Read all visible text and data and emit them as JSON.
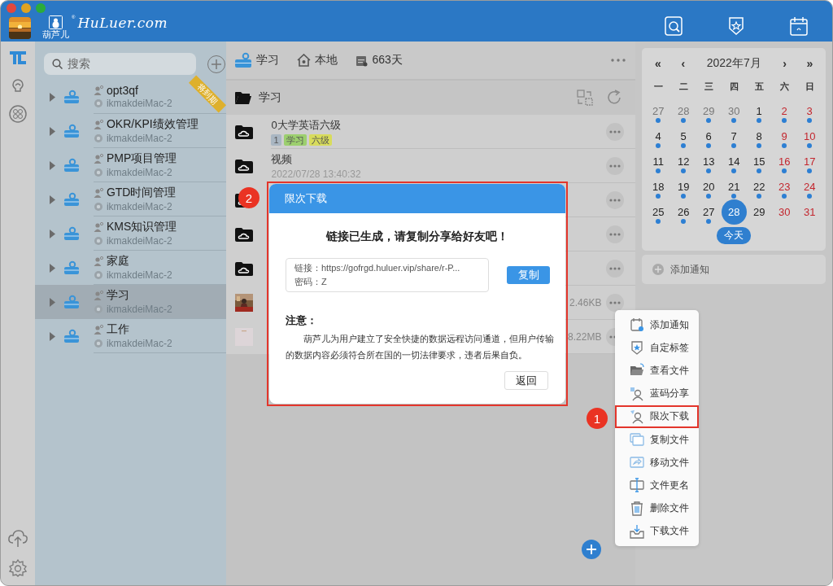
{
  "window": {
    "logo_text": "HuLuer.com",
    "logo_registered": "®",
    "logo_caption": "葫芦儿"
  },
  "sidebar": {
    "search_placeholder": "搜索",
    "items": [
      {
        "name": "opt3qf",
        "device": "ikmakdeiMac-2",
        "selected": false,
        "ribbon": "将到期"
      },
      {
        "name": "OKR/KPI绩效管理",
        "device": "ikmakdeiMac-2",
        "selected": false
      },
      {
        "name": "PMP项目管理",
        "device": "ikmakdeiMac-2",
        "selected": false
      },
      {
        "name": "GTD时间管理",
        "device": "ikmakdeiMac-2",
        "selected": false
      },
      {
        "name": "KMS知识管理",
        "device": "ikmakdeiMac-2",
        "selected": false
      },
      {
        "name": "家庭",
        "device": "ikmakdeiMac-2",
        "selected": false
      },
      {
        "name": "学习",
        "device": "ikmakdeiMac-2",
        "selected": true
      },
      {
        "name": "工作",
        "device": "ikmakdeiMac-2",
        "selected": false
      }
    ]
  },
  "toolbar": {
    "drive": "学习",
    "location": "本地",
    "days": "663天"
  },
  "breadcrumb": "学习",
  "files": [
    {
      "kind": "folder",
      "name": "0大学英语六级",
      "tags": [
        {
          "label": "1",
          "color": "#a9b6c2"
        },
        {
          "label": "学习",
          "color": "#9ccf6e"
        },
        {
          "label": "六级",
          "color": "#d8dc5c"
        }
      ]
    },
    {
      "kind": "folder",
      "name": "视频",
      "date": "2022/07/28 13:40:32"
    },
    {
      "kind": "folder"
    },
    {
      "kind": "folder"
    },
    {
      "kind": "folder"
    },
    {
      "kind": "picture",
      "size": "2.46KB"
    },
    {
      "kind": "document",
      "size": "8.22MB"
    }
  ],
  "dialog": {
    "title": "限次下载",
    "heading": "链接已生成，请复制分享给好友吧！",
    "link_label": "链接：",
    "link": "https://gofrgd.huluer.vip/share/r-P...",
    "password_label": "密码：",
    "password": "Z",
    "copy_button": "复制",
    "notice_title": "注意：",
    "notice": "葫芦儿为用户建立了安全快捷的数据远程访问通道，但用户传输的数据内容必须符合所在国的一切法律要求，违者后果自负。",
    "back_button": "返回"
  },
  "context_menu": {
    "items": [
      {
        "label": "添加通知",
        "selected": false
      },
      {
        "label": "自定标签",
        "selected": false
      },
      {
        "label": "查看文件",
        "selected": false
      },
      {
        "label": "蓝码分享",
        "selected": false
      },
      {
        "label": "限次下载",
        "selected": true
      },
      {
        "label": "复制文件",
        "selected": false
      },
      {
        "label": "移动文件",
        "selected": false
      },
      {
        "label": "文件更名",
        "selected": false
      },
      {
        "label": "删除文件",
        "selected": false
      },
      {
        "label": "下载文件",
        "selected": false
      }
    ]
  },
  "step_markers": [
    {
      "label": "2"
    },
    {
      "label": "1"
    }
  ],
  "calendar": {
    "prev_year": "«",
    "prev_month": "‹",
    "title": "2022年7月",
    "next_month": "›",
    "next_year": "»",
    "weekdays": [
      "一",
      "二",
      "三",
      "四",
      "五",
      "六",
      "日"
    ],
    "days": [
      {
        "day": "27",
        "other_month": true,
        "weekend": false,
        "event": true,
        "selected": false
      },
      {
        "day": "28",
        "other_month": true,
        "weekend": false,
        "event": true,
        "selected": false
      },
      {
        "day": "29",
        "other_month": true,
        "weekend": false,
        "event": true,
        "selected": false
      },
      {
        "day": "30",
        "other_month": true,
        "weekend": false,
        "event": true,
        "selected": false
      },
      {
        "day": "1",
        "other_month": false,
        "weekend": false,
        "event": true,
        "selected": false
      },
      {
        "day": "2",
        "other_month": false,
        "weekend": true,
        "event": true,
        "selected": false
      },
      {
        "day": "3",
        "other_month": false,
        "weekend": true,
        "event": true,
        "selected": false
      },
      {
        "day": "4",
        "other_month": false,
        "weekend": false,
        "event": true,
        "selected": false
      },
      {
        "day": "5",
        "other_month": false,
        "weekend": false,
        "event": true,
        "selected": false
      },
      {
        "day": "6",
        "other_month": false,
        "weekend": false,
        "event": true,
        "selected": false
      },
      {
        "day": "7",
        "other_month": false,
        "weekend": false,
        "event": true,
        "selected": false
      },
      {
        "day": "8",
        "other_month": false,
        "weekend": false,
        "event": true,
        "selected": false
      },
      {
        "day": "9",
        "other_month": false,
        "weekend": true,
        "event": true,
        "selected": false
      },
      {
        "day": "10",
        "other_month": false,
        "weekend": true,
        "event": true,
        "selected": false
      },
      {
        "day": "11",
        "other_month": false,
        "weekend": false,
        "event": true,
        "selected": false
      },
      {
        "day": "12",
        "other_month": false,
        "weekend": false,
        "event": true,
        "selected": false
      },
      {
        "day": "13",
        "other_month": false,
        "weekend": false,
        "event": true,
        "selected": false
      },
      {
        "day": "14",
        "other_month": false,
        "weekend": false,
        "event": true,
        "selected": false
      },
      {
        "day": "15",
        "other_month": false,
        "weekend": false,
        "event": true,
        "selected": false
      },
      {
        "day": "16",
        "other_month": false,
        "weekend": true,
        "event": true,
        "selected": false
      },
      {
        "day": "17",
        "other_month": false,
        "weekend": true,
        "event": true,
        "selected": false
      },
      {
        "day": "18",
        "other_month": false,
        "weekend": false,
        "event": true,
        "selected": false
      },
      {
        "day": "19",
        "other_month": false,
        "weekend": false,
        "event": true,
        "selected": false
      },
      {
        "day": "20",
        "other_month": false,
        "weekend": false,
        "event": true,
        "selected": false
      },
      {
        "day": "21",
        "other_month": false,
        "weekend": false,
        "event": true,
        "selected": false
      },
      {
        "day": "22",
        "other_month": false,
        "weekend": false,
        "event": true,
        "selected": false
      },
      {
        "day": "23",
        "other_month": false,
        "weekend": true,
        "event": true,
        "selected": false
      },
      {
        "day": "24",
        "other_month": false,
        "weekend": true,
        "event": true,
        "selected": false
      },
      {
        "day": "25",
        "other_month": false,
        "weekend": false,
        "event": true,
        "selected": false
      },
      {
        "day": "26",
        "other_month": false,
        "weekend": false,
        "event": true,
        "selected": false
      },
      {
        "day": "27",
        "other_month": false,
        "weekend": false,
        "event": true,
        "selected": false
      },
      {
        "day": "28",
        "other_month": false,
        "weekend": false,
        "event": false,
        "selected": true
      },
      {
        "day": "29",
        "other_month": false,
        "weekend": false,
        "event": false,
        "selected": false
      },
      {
        "day": "30",
        "other_month": false,
        "weekend": true,
        "event": false,
        "selected": false
      },
      {
        "day": "31",
        "other_month": false,
        "weekend": true,
        "event": false,
        "selected": false
      }
    ],
    "today_button": "今天"
  },
  "notifications": {
    "add_label": "添加通知"
  }
}
